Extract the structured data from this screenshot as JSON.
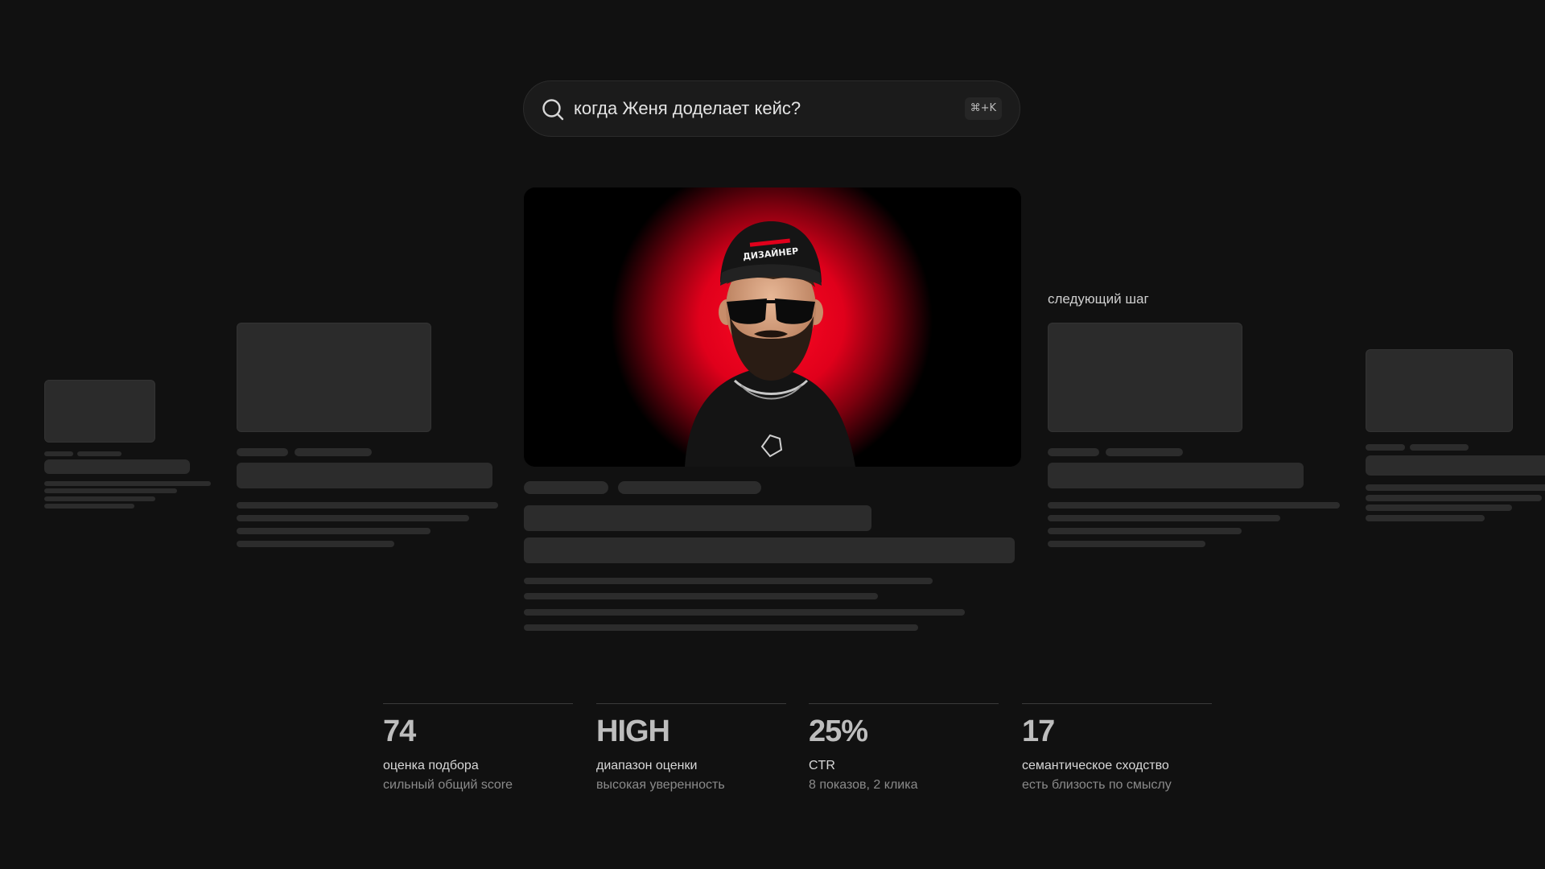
{
  "search": {
    "query": "когда Женя доделает кейс?",
    "shortcut": "⌘+K",
    "icon": "search-icon"
  },
  "hero": {
    "cap_text": "ДИЗАЙНЕР",
    "accent_color": "#e0001b"
  },
  "next_step": {
    "label": "следующий шаг"
  },
  "metrics": [
    {
      "value": "74",
      "label": "оценка подбора",
      "sub": "сильный общий score"
    },
    {
      "value": "HIGH",
      "label": "диапазон оценки",
      "sub": "высокая уверенность"
    },
    {
      "value": "25%",
      "label": "CTR",
      "sub": "8 показов, 2 клика"
    },
    {
      "value": "17",
      "label": "семантическое сходство",
      "sub": "есть близость по смыслу"
    }
  ]
}
